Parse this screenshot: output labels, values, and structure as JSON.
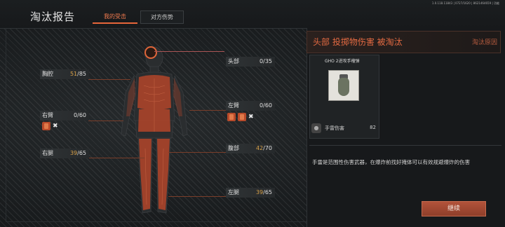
{
  "header": {
    "title": "淘汰报告",
    "tabs": [
      {
        "label": "我的受击",
        "active": true
      },
      {
        "label": "对方伤势",
        "active": false
      }
    ],
    "system_info": "1.0.118.11843 | 0727/1620 | 8621464659 | 功能"
  },
  "body_parts": {
    "head": {
      "label": "头部",
      "value": "0/35"
    },
    "chest": {
      "label": "胸腔",
      "current": "51",
      "max": "/85"
    },
    "right_arm": {
      "label": "右臂",
      "value": "0/60"
    },
    "left_arm": {
      "label": "左臂",
      "value": "0/60"
    },
    "abdomen": {
      "label": "腹部",
      "current": "42",
      "max": "/70"
    },
    "right_leg": {
      "label": "右腿",
      "current": "39",
      "max": "/65"
    },
    "left_leg": {
      "label": "左腿",
      "current": "39",
      "max": "/65"
    }
  },
  "elimination": {
    "cause": "头部  投掷物伤害  被淘汰",
    "cause_link": "淘汰原因",
    "weapon_name": "GHO 2进攻手榴弹",
    "weapon_icon": "grenade-icon",
    "damage_label": "手雷伤害",
    "damage_value": "82",
    "description": "手雷是范围性伤害武器，在爆炸前找好掩体可以有效规避爆炸的伤害"
  },
  "actions": {
    "continue_label": "继续"
  },
  "colors": {
    "accent": "#e8663a",
    "highlight_value": "#d8a24a",
    "button": "#a04a32"
  }
}
